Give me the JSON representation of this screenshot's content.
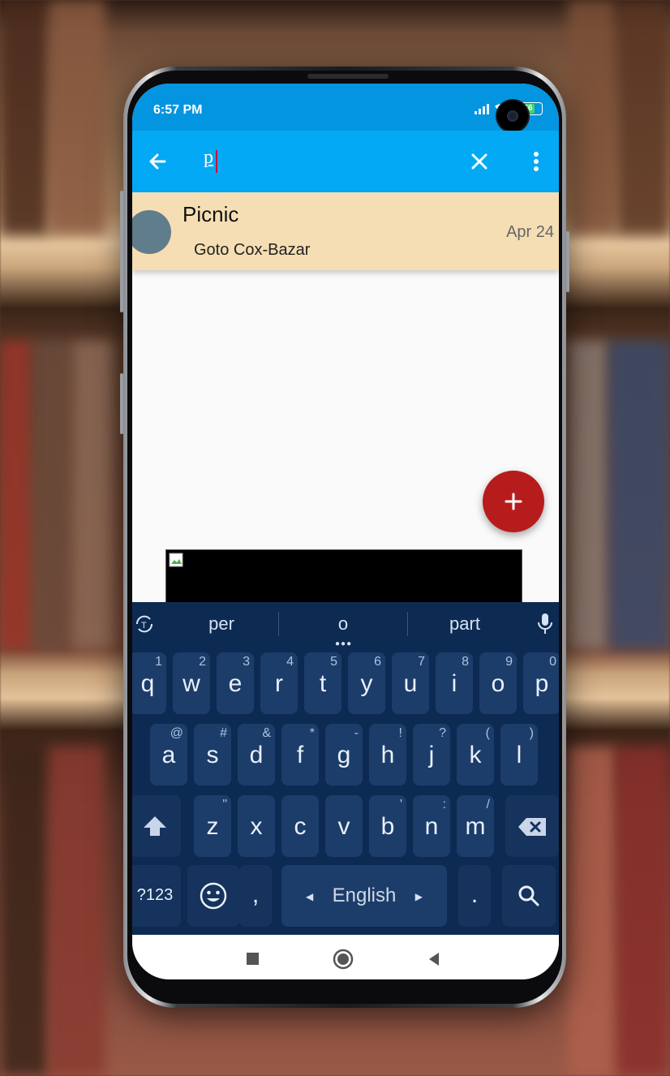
{
  "status": {
    "time": "6:57 PM",
    "battery": "66"
  },
  "search": {
    "query": "p",
    "placeholder": ""
  },
  "results": [
    {
      "title": "Picnic",
      "subtitle": "Goto Cox-Bazar",
      "date": "Apr 24"
    }
  ],
  "keyboard": {
    "suggestions": [
      "per",
      "o",
      "part"
    ],
    "row1": [
      {
        "k": "q",
        "h": "1"
      },
      {
        "k": "w",
        "h": "2"
      },
      {
        "k": "e",
        "h": "3"
      },
      {
        "k": "r",
        "h": "4"
      },
      {
        "k": "t",
        "h": "5"
      },
      {
        "k": "y",
        "h": "6"
      },
      {
        "k": "u",
        "h": "7"
      },
      {
        "k": "i",
        "h": "8"
      },
      {
        "k": "o",
        "h": "9"
      },
      {
        "k": "p",
        "h": "0"
      }
    ],
    "row2": [
      {
        "k": "a",
        "h": "@"
      },
      {
        "k": "s",
        "h": "#"
      },
      {
        "k": "d",
        "h": "&"
      },
      {
        "k": "f",
        "h": "*"
      },
      {
        "k": "g",
        "h": "-"
      },
      {
        "k": "h",
        "h": "!"
      },
      {
        "k": "j",
        "h": "?"
      },
      {
        "k": "k",
        "h": "("
      },
      {
        "k": "l",
        "h": ")"
      }
    ],
    "row3": [
      {
        "k": "z",
        "h": "\""
      },
      {
        "k": "x",
        "h": ""
      },
      {
        "k": "c",
        "h": ""
      },
      {
        "k": "v",
        "h": ""
      },
      {
        "k": "b",
        "h": "'"
      },
      {
        "k": "n",
        "h": ":"
      },
      {
        "k": "m",
        "h": "/"
      }
    ],
    "symbols_label": "?123",
    "comma": ",",
    "space_label": "English",
    "period": "."
  },
  "colors": {
    "status_bar": "#0495e0",
    "app_bar": "#03a9f4",
    "result_bg": "#f5deb3",
    "fab": "#b71c1c",
    "keyboard_bg": "#0d2a52"
  },
  "icons": {
    "back": "arrow-left-icon",
    "clear": "close-icon",
    "menu": "more-vert-icon",
    "fab": "plus-icon"
  }
}
